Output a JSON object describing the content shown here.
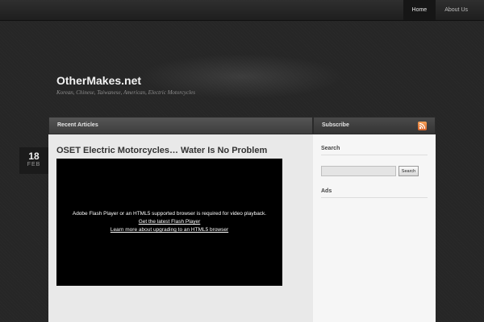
{
  "nav": {
    "items": [
      {
        "label": "Home",
        "active": true
      },
      {
        "label": "About Us",
        "active": false
      }
    ]
  },
  "site": {
    "title": "OtherMakes.net",
    "tagline": "Korean, Chinese, Taiwanese, American, Electric Motorcycles"
  },
  "main": {
    "section_title": "Recent Articles",
    "post": {
      "date_day": "18",
      "date_month": "FEB",
      "title": "OSET Electric Motorcycles… Water Is No Problem",
      "video": {
        "message": "Adobe Flash Player or an HTML5 supported browser is required for video playback.",
        "link1": "Get the latest Flash Player",
        "link2": "Learn more about upgrading to an HTML5 browser"
      }
    }
  },
  "sidebar": {
    "subscribe_label": "Subscribe",
    "subscribe_icon": "rss-icon",
    "search_heading": "Search",
    "search_button": "Search",
    "search_value": "",
    "ads_heading": "Ads"
  },
  "colors": {
    "background": "#262626",
    "content_bg": "#e9e9e9",
    "sidebar_bg": "#f6f6f6",
    "rss_accent": "#e07b39"
  }
}
